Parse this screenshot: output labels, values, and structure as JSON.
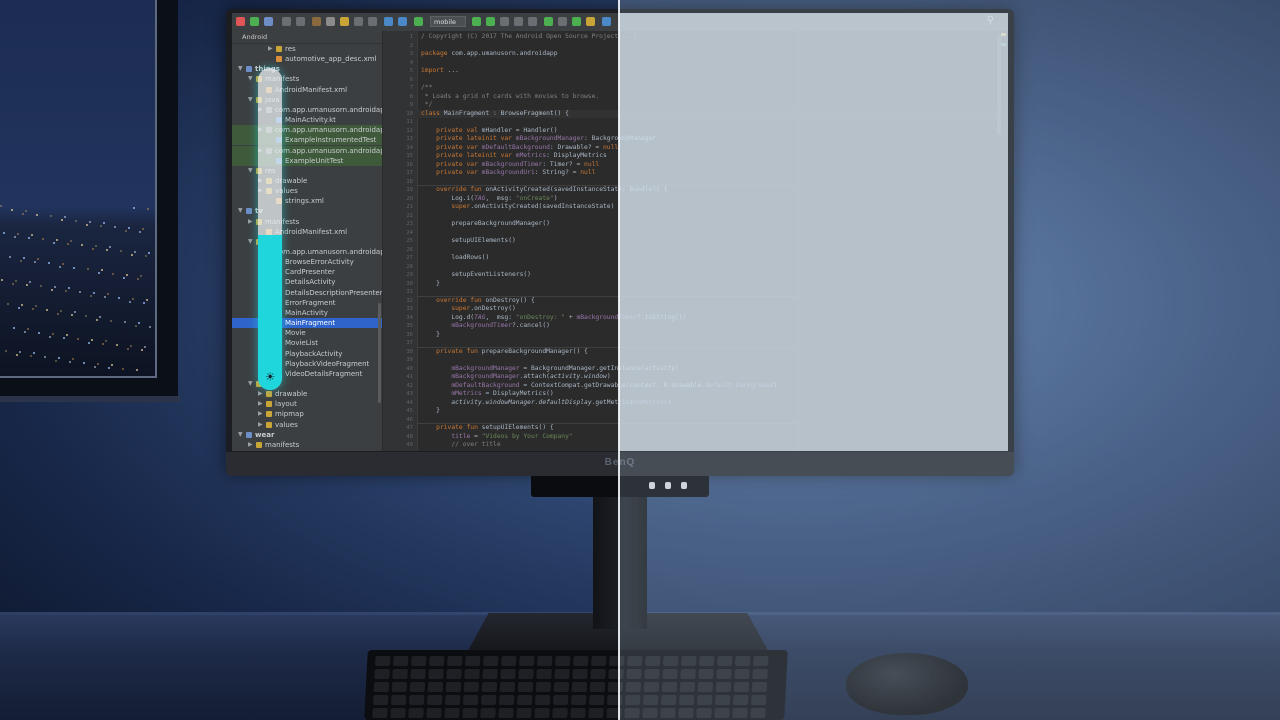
{
  "ide": {
    "project_view_label": "Android",
    "run_config": "mobile",
    "tree": [
      {
        "label": "res",
        "depth": 4,
        "type": "folder"
      },
      {
        "label": "automotive_app_desc.xml",
        "depth": 4,
        "type": "file"
      },
      {
        "label": "things",
        "depth": 1,
        "type": "module",
        "open": true
      },
      {
        "label": "manifests",
        "depth": 2,
        "type": "folder",
        "open": true
      },
      {
        "label": "AndroidManifest.xml",
        "depth": 3,
        "type": "file"
      },
      {
        "label": "java",
        "depth": 2,
        "type": "folder",
        "open": true
      },
      {
        "label": "com.app.umanusorn.androidapp",
        "depth": 3,
        "type": "package"
      },
      {
        "label": "MainActivity.kt",
        "depth": 4,
        "type": "kt"
      },
      {
        "label": "com.app.umanusorn.androidapp",
        "depth": 3,
        "type": "package",
        "green": true
      },
      {
        "label": "ExampleInstrumentedTest",
        "depth": 4,
        "type": "kt",
        "green": true
      },
      {
        "label": "com.app.umanusorn.androidapp",
        "depth": 3,
        "type": "package",
        "green": true
      },
      {
        "label": "ExampleUnitTest",
        "depth": 4,
        "type": "kt",
        "green": true
      },
      {
        "label": "res",
        "depth": 2,
        "type": "folder",
        "open": true
      },
      {
        "label": "drawable",
        "depth": 3,
        "type": "folder"
      },
      {
        "label": "values",
        "depth": 3,
        "type": "folder"
      },
      {
        "label": "strings.xml",
        "depth": 4,
        "type": "file"
      },
      {
        "label": "tv",
        "depth": 1,
        "type": "module",
        "open": true
      },
      {
        "label": "manifests",
        "depth": 2,
        "type": "folder"
      },
      {
        "label": "AndroidManifest.xml",
        "depth": 3,
        "type": "file"
      },
      {
        "label": "java",
        "depth": 2,
        "type": "folder",
        "open": true
      },
      {
        "label": "com.app.umanusorn.androidapp",
        "depth": 3,
        "type": "package"
      },
      {
        "label": "BrowseErrorActivity",
        "depth": 4,
        "type": "kt"
      },
      {
        "label": "CardPresenter",
        "depth": 4,
        "type": "kt"
      },
      {
        "label": "DetailsActivity",
        "depth": 4,
        "type": "kt"
      },
      {
        "label": "DetailsDescriptionPresenter",
        "depth": 4,
        "type": "kt"
      },
      {
        "label": "ErrorFragment",
        "depth": 4,
        "type": "kt"
      },
      {
        "label": "MainActivity",
        "depth": 4,
        "type": "kt"
      },
      {
        "label": "MainFragment",
        "depth": 4,
        "type": "kt",
        "selected": true
      },
      {
        "label": "Movie",
        "depth": 4,
        "type": "kt"
      },
      {
        "label": "MovieList",
        "depth": 4,
        "type": "kt"
      },
      {
        "label": "PlaybackActivity",
        "depth": 4,
        "type": "kt"
      },
      {
        "label": "PlaybackVideoFragment",
        "depth": 4,
        "type": "kt"
      },
      {
        "label": "VideoDetailsFragment",
        "depth": 4,
        "type": "kt"
      },
      {
        "label": "res",
        "depth": 2,
        "type": "folder",
        "open": true
      },
      {
        "label": "drawable",
        "depth": 3,
        "type": "folder"
      },
      {
        "label": "layout",
        "depth": 3,
        "type": "folder"
      },
      {
        "label": "mipmap",
        "depth": 3,
        "type": "folder"
      },
      {
        "label": "values",
        "depth": 3,
        "type": "folder"
      },
      {
        "label": "wear",
        "depth": 1,
        "type": "module",
        "open": true
      },
      {
        "label": "manifests",
        "depth": 2,
        "type": "folder"
      },
      {
        "label": "AndroidManifest.xml",
        "depth": 3,
        "type": "file"
      }
    ],
    "code": [
      {
        "ln": 1,
        "html": "<span class=\"cm\">/ Copyright (C) 2017 The Android Open Source Project .../</span>"
      },
      {
        "ln": 2,
        "html": ""
      },
      {
        "ln": 3,
        "html": "<span class=\"kw\">package</span> com.app.umanusorn.androidapp"
      },
      {
        "ln": 4,
        "html": ""
      },
      {
        "ln": 5,
        "html": "<span class=\"kw\">import</span> ..."
      },
      {
        "ln": 6,
        "html": ""
      },
      {
        "ln": 7,
        "html": "<span class=\"cm\">/**</span>"
      },
      {
        "ln": 8,
        "html": "<span class=\"cm\"> * Loads a grid of cards with movies to browse.</span>"
      },
      {
        "ln": 9,
        "html": "<span class=\"cm\"> */</span>"
      },
      {
        "ln": 10,
        "html": "<span class=\"kw\">class</span> MainFragment : BrowseFragment() {",
        "hl": true
      },
      {
        "ln": 11,
        "html": ""
      },
      {
        "ln": 12,
        "html": "    <span class=\"kw\">private val</span> mHandler = Handler()"
      },
      {
        "ln": 13,
        "html": "    <span class=\"kw\">private lateinit var</span> <span class=\"fd\">mBackgroundManager</span>: BackgroundManager"
      },
      {
        "ln": 14,
        "html": "    <span class=\"kw\">private var</span> <span class=\"fd\">mDefaultBackground</span>: Drawable? = <span class=\"kw\">null</span>"
      },
      {
        "ln": 15,
        "html": "    <span class=\"kw\">private lateinit var</span> <span class=\"fd\">mMetrics</span>: DisplayMetrics"
      },
      {
        "ln": 16,
        "html": "    <span class=\"kw\">private var</span> <span class=\"fd\">mBackgroundTimer</span>: Timer? = <span class=\"kw\">null</span>"
      },
      {
        "ln": 17,
        "html": "    <span class=\"kw\">private var</span> <span class=\"fd\">mBackgroundUri</span>: String? = <span class=\"kw\">null</span>"
      },
      {
        "ln": 18,
        "html": ""
      },
      {
        "ln": 19,
        "html": "    <span class=\"kw\">override fun</span> onActivityCreated(savedInstanceState: Bundle?) {",
        "sep": true
      },
      {
        "ln": 20,
        "html": "        Log.i(<span class=\"fd it\">TAG</span>,  msg: <span class=\"st\">\"onCreate\"</span>)"
      },
      {
        "ln": 21,
        "html": "        <span class=\"kw\">super</span>.onActivityCreated(savedInstanceState)"
      },
      {
        "ln": 22,
        "html": ""
      },
      {
        "ln": 23,
        "html": "        prepareBackgroundManager()"
      },
      {
        "ln": 24,
        "html": ""
      },
      {
        "ln": 25,
        "html": "        setupUIElements()"
      },
      {
        "ln": 26,
        "html": ""
      },
      {
        "ln": 27,
        "html": "        loadRows()"
      },
      {
        "ln": 28,
        "html": ""
      },
      {
        "ln": 29,
        "html": "        setupEventListeners()"
      },
      {
        "ln": 30,
        "html": "    }"
      },
      {
        "ln": 31,
        "html": ""
      },
      {
        "ln": 32,
        "html": "    <span class=\"kw\">override fun</span> onDestroy() {",
        "sep": true
      },
      {
        "ln": 33,
        "html": "        <span class=\"kw\">super</span>.onDestroy()"
      },
      {
        "ln": 34,
        "html": "        Log.d(<span class=\"fd it\">TAG</span>,  msg: <span class=\"st\">\"onDestroy: \"</span> + <span class=\"fd\">mBackgroundTimer</span>?.toString())"
      },
      {
        "ln": 35,
        "html": "        <span class=\"fd\">mBackgroundTimer</span>?.cancel()"
      },
      {
        "ln": 36,
        "html": "    }"
      },
      {
        "ln": 37,
        "html": ""
      },
      {
        "ln": 38,
        "html": "    <span class=\"kw\">private fun</span> prepareBackgroundManager() {",
        "sep": true
      },
      {
        "ln": 39,
        "html": ""
      },
      {
        "ln": 40,
        "html": "        <span class=\"fd\">mBackgroundManager</span> = BackgroundManager.getInstance(<span class=\"it\">activity</span>)"
      },
      {
        "ln": 41,
        "html": "        <span class=\"fd\">mBackgroundManager</span>.attach(<span class=\"it\">activity.window</span>)"
      },
      {
        "ln": 42,
        "html": "        <span class=\"fd\">mDefaultBackground</span> = ContextCompat.getDrawable(<span class=\"it\">context</span>, R.drawable.<span class=\"fd it\">default_background</span>)"
      },
      {
        "ln": 43,
        "html": "        <span class=\"fd\">mMetrics</span> = DisplayMetrics()"
      },
      {
        "ln": 44,
        "html": "        <span class=\"it\">activity.windowManager.defaultDisplay</span>.getMetrics(<span class=\"fd\">mMetrics</span>)"
      },
      {
        "ln": 45,
        "html": "    }"
      },
      {
        "ln": 46,
        "html": ""
      },
      {
        "ln": 47,
        "html": "    <span class=\"kw\">private fun</span> setupUIElements() {",
        "sep": true
      },
      {
        "ln": 48,
        "html": "        <span class=\"fd\">title</span> = <span class=\"st\">\"Videos by Your Company\"</span>"
      },
      {
        "ln": 49,
        "html": "        <span class=\"cm\">// over title</span>"
      }
    ]
  },
  "monitor": {
    "brand": "BenQ",
    "brightness_level": 0.48
  },
  "colors": {
    "light_bar_fill": "#1fd6dc",
    "ide_background": "#2b2b2b",
    "selection": "#2f65ca"
  }
}
